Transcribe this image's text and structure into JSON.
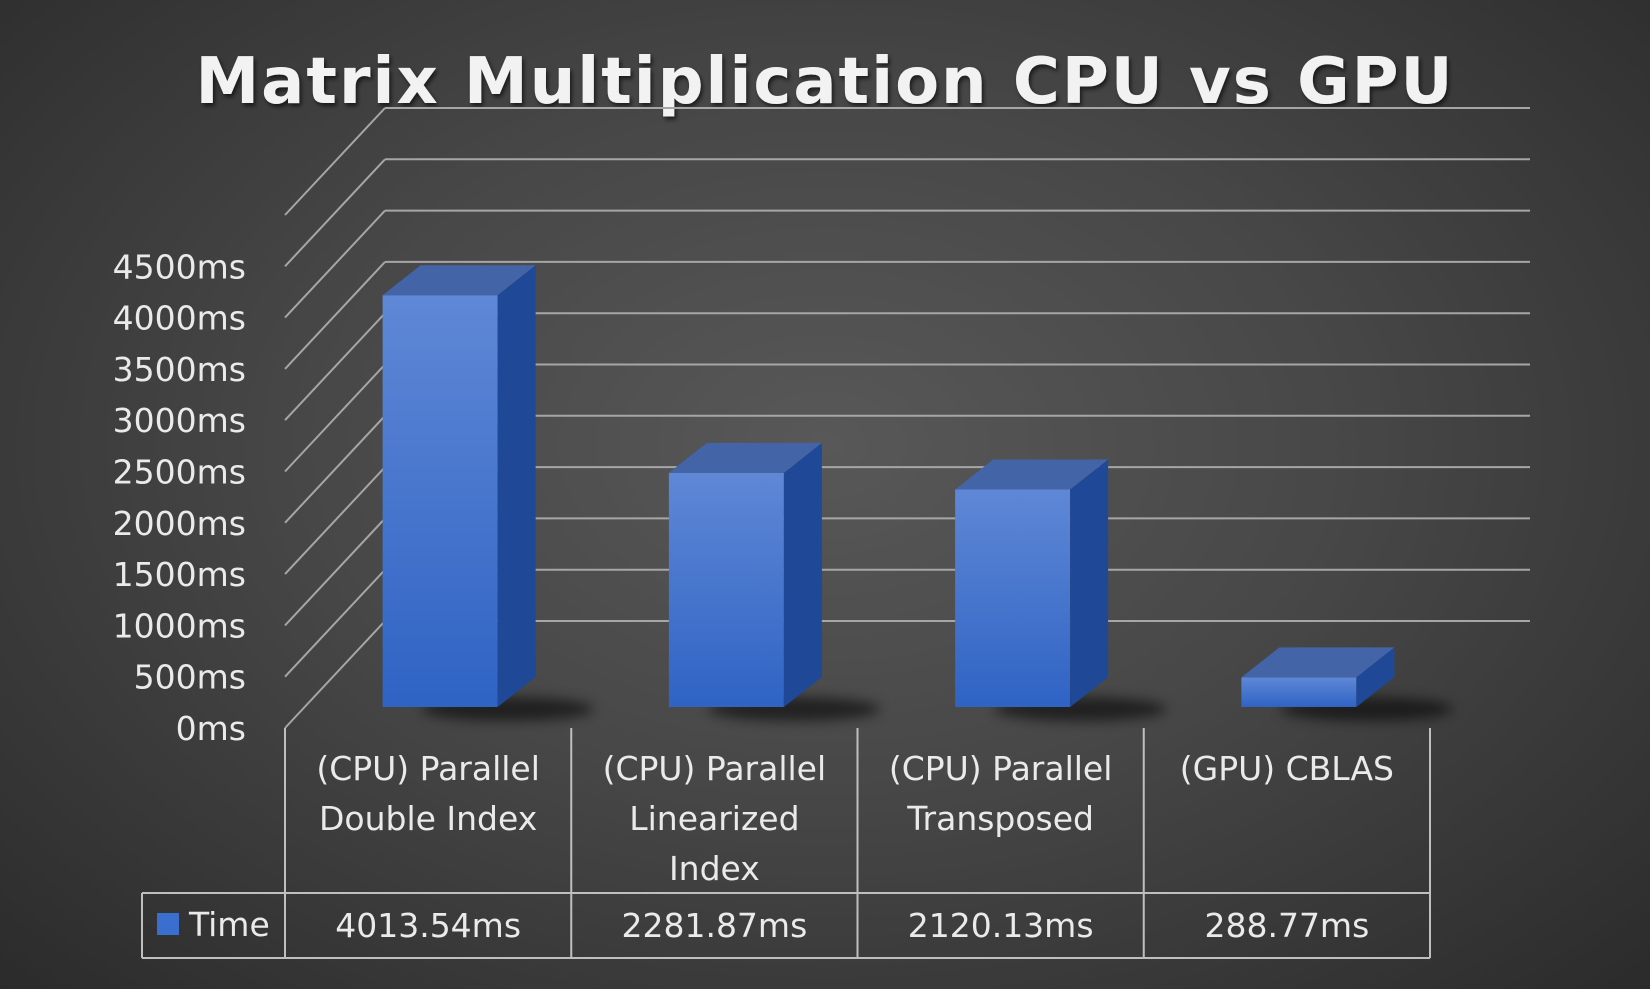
{
  "chart_data": {
    "type": "bar",
    "title": "Matrix Multiplication CPU vs GPU",
    "categories": [
      [
        "(CPU) Parallel",
        "Double Index"
      ],
      [
        "(CPU) Parallel",
        "Linearized",
        "Index"
      ],
      [
        "(CPU) Parallel",
        "Transposed"
      ],
      [
        "(GPU) CBLAS"
      ]
    ],
    "series": [
      {
        "name": "Time",
        "values": [
          4013.54,
          2281.87,
          2120.13,
          288.77
        ],
        "value_labels": [
          "4013.54ms",
          "2281.87ms",
          "2120.13ms",
          "288.77ms"
        ],
        "color": "#3a6fd0"
      }
    ],
    "y_ticks": [
      "0ms",
      "500ms",
      "1000ms",
      "1500ms",
      "2000ms",
      "2500ms",
      "3000ms",
      "3500ms",
      "4000ms",
      "4500ms"
    ],
    "ylim": [
      0,
      5000
    ],
    "y_tick_step": 500,
    "grid": true,
    "style": "3d-column",
    "data_table": true,
    "legend_placement": "data-table-left",
    "colors": {
      "bar_front_top": "#5f88d6",
      "bar_front_bottom": "#2f63c4",
      "bar_side": "#1f4896",
      "bar_top": "#4464a8",
      "gridline": "#a6a6a6",
      "text": "#eaeaea"
    }
  }
}
